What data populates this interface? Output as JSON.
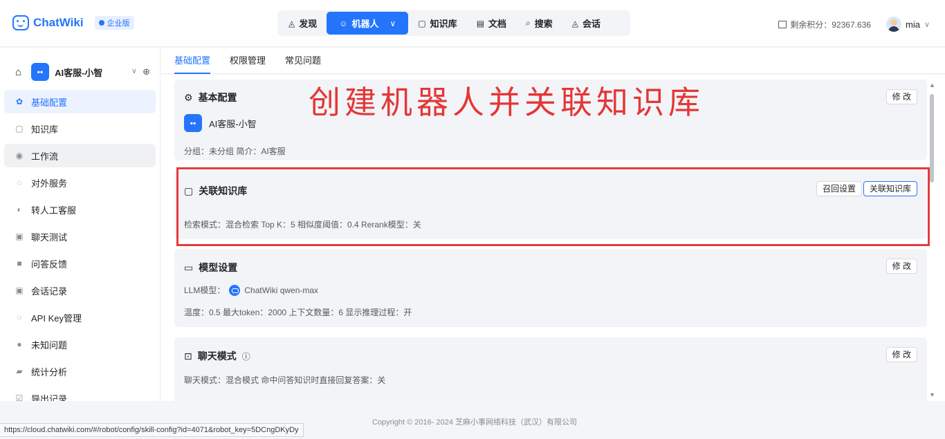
{
  "brand": {
    "name": "ChatWiki",
    "edition": "企业版"
  },
  "nav": [
    {
      "icon": "discover-icon",
      "glyph": "◬",
      "label": "发现"
    },
    {
      "icon": "robot-icon",
      "glyph": "☺",
      "label": "机器人",
      "active": true
    },
    {
      "icon": "book-icon",
      "glyph": "▢",
      "label": "知识库"
    },
    {
      "icon": "doc-icon",
      "glyph": "▤",
      "label": "文档"
    },
    {
      "icon": "search-icon",
      "glyph": "⌕",
      "label": "搜索"
    },
    {
      "icon": "chat-icon",
      "glyph": "◬",
      "label": "会话"
    }
  ],
  "topbar": {
    "credit": "剩余积分：92367.636",
    "user": "mia"
  },
  "sidebar": {
    "robot_name": "AI客服-小智",
    "items": [
      {
        "icon": "gear-icon",
        "glyph": "✿",
        "label": "基础配置"
      },
      {
        "icon": "book-icon",
        "glyph": "▢",
        "label": "知识库"
      },
      {
        "icon": "workflow-icon",
        "glyph": "◉",
        "label": "工作流"
      },
      {
        "icon": "service-icon",
        "glyph": "◌",
        "label": "对外服务"
      },
      {
        "icon": "headset-icon",
        "glyph": "◐",
        "label": "转人工客服"
      },
      {
        "icon": "chat-test-icon",
        "glyph": "▣",
        "label": "聊天测试"
      },
      {
        "icon": "feedback-icon",
        "glyph": "■",
        "label": "问答反馈"
      },
      {
        "icon": "history-icon",
        "glyph": "▣",
        "label": "会话记录"
      },
      {
        "icon": "key-icon",
        "glyph": "◌",
        "label": "API Key管理"
      },
      {
        "icon": "question-icon",
        "glyph": "●",
        "label": "未知问题"
      },
      {
        "icon": "stats-icon",
        "glyph": "▰",
        "label": "统计分析"
      },
      {
        "icon": "export-icon",
        "glyph": "☑",
        "label": "导出记录"
      }
    ]
  },
  "tabs": [
    "基础配置",
    "权限管理",
    "常见问题"
  ],
  "overlay_title": "创建机器人并关联知识库",
  "basic": {
    "title": "基本配置",
    "edit": "修 改",
    "name": "AI客服-小智",
    "meta": "分组：未分组  简介：AI客服"
  },
  "kb": {
    "title": "关联知识库",
    "recall_btn": "召回设置",
    "link_btn": "关联知识库",
    "meta": "检索模式：混合检索    Top K：5    相似度阈值：0.4    Rerank模型：关"
  },
  "model": {
    "title": "模型设置",
    "edit": "修 改",
    "llm_label": "LLM模型：",
    "llm_value": "ChatWiki qwen-max",
    "meta": "温度：0.5    最大token：2000    上下文数量：6    显示推理过程：开"
  },
  "chatmode": {
    "title": "聊天模式",
    "edit": "修 改",
    "meta": "聊天模式：混合模式    命中问答知识时直接回复答案：关"
  },
  "footer": {
    "copyright": "Copyright © 2016- 2024 芝麻小事网络科技（武汉）有限公司",
    "status_url": "https://cloud.chatwiki.com/#/robot/config/skill-config?id=4071&robot_key=5DCngDKyDy"
  },
  "colors": {
    "accent": "#2475fc",
    "highlight": "#e53a3a"
  }
}
